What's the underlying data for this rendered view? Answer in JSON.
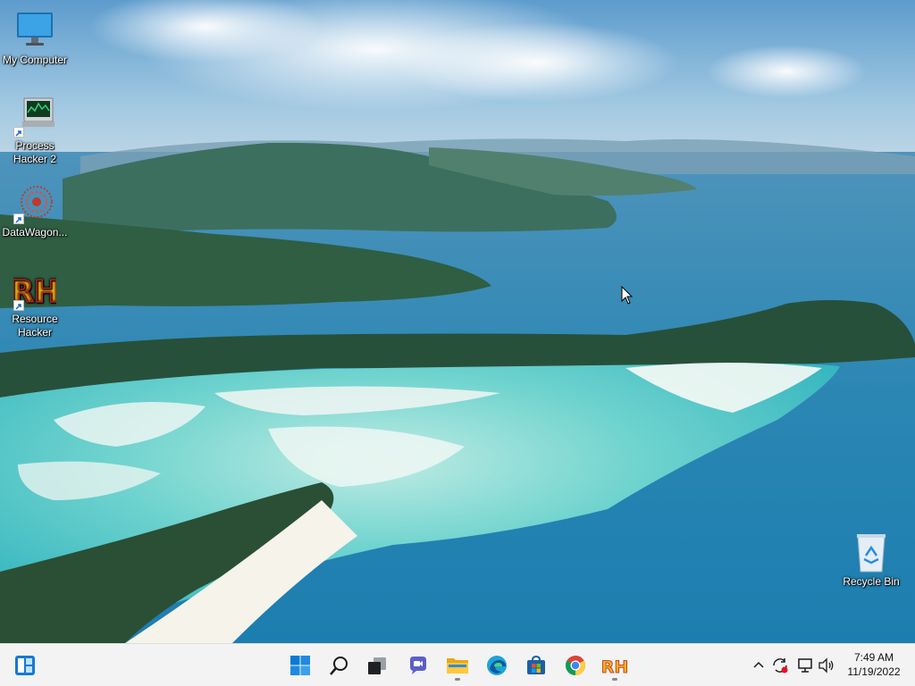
{
  "desktop": {
    "icons": [
      {
        "label": "My Computer",
        "icon": "monitor-icon"
      },
      {
        "label": "Process Hacker 2",
        "icon": "process-hacker-icon"
      },
      {
        "label": "DataWagon...",
        "icon": "datawagon-icon"
      },
      {
        "label": "Resource Hacker",
        "icon": "resource-hacker-icon"
      },
      {
        "label": "Recycle Bin",
        "icon": "recycle-bin-icon"
      }
    ],
    "rh_logo_text": "RH"
  },
  "taskbar": {
    "apps": [
      {
        "icon": "widgets-icon"
      },
      {
        "icon": "windows-start-icon"
      },
      {
        "icon": "search-icon"
      },
      {
        "icon": "task-view-icon"
      },
      {
        "icon": "chat-icon"
      },
      {
        "icon": "file-explorer-icon"
      },
      {
        "icon": "edge-icon"
      },
      {
        "icon": "store-icon"
      },
      {
        "icon": "chrome-icon"
      },
      {
        "icon": "resource-hacker-icon"
      }
    ],
    "tray": {
      "icons": [
        "chevron-up-icon",
        "sync-icon",
        "network-icon",
        "volume-icon"
      ],
      "time": "7:49 AM",
      "date": "11/19/2022"
    }
  },
  "colors": {
    "sky": "#7fb3d8",
    "sea": "#2f8fb8",
    "lagoon": "#4fc7c9",
    "taskbar": "#f3f3f3",
    "windows_blue": "#0078d4"
  }
}
